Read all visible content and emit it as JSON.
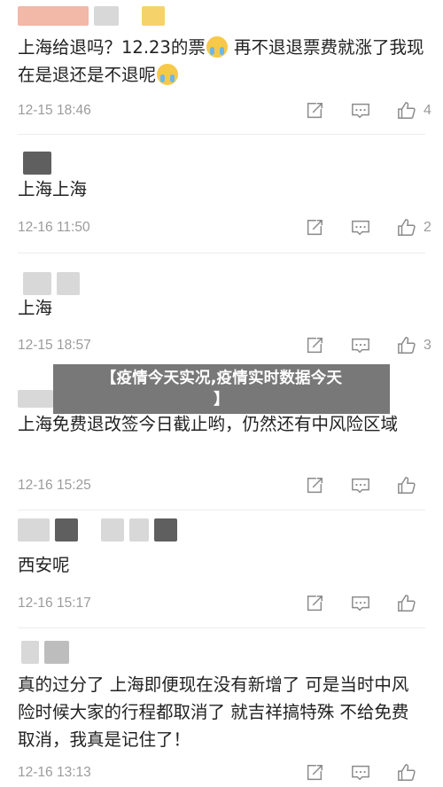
{
  "comments": [
    {
      "text_part1": "上海给退吗？12.23的票",
      "text_part2": " 再不退退票费就涨了我现在是退还是不退呢",
      "emoji_1": "crying-face-emoji",
      "emoji_2": "crying-face-emoji",
      "time": "12-15 18:46",
      "likes": "4"
    },
    {
      "text": "上海上海",
      "time": "12-16 11:50",
      "likes": "2"
    },
    {
      "text": "上海",
      "time": "12-15 18:57",
      "likes": "3"
    },
    {
      "text": "上海免费退改签今日截止哟，仍然还有中风险区域",
      "time": "12-16 15:25",
      "likes": ""
    },
    {
      "text": "西安呢",
      "time": "12-16 15:17",
      "likes": ""
    },
    {
      "text": "真的过分了 上海即便现在没有新增了 可是当时中风险时候大家的行程都取消了 就吉祥搞特殊 不给免费取消，我真是记住了！",
      "time": "12-16 13:13",
      "likes": ""
    }
  ],
  "banner": {
    "line1": "【疫情今天实况,疫情实时数据今天",
    "line2": "】"
  },
  "icons": {
    "share": "share-icon",
    "reply": "comment-icon",
    "like": "thumbs-up-icon"
  },
  "colors": {
    "time_text": "#9b9b9b",
    "icon_stroke": "#8a8a8a",
    "banner_bg": "#5a5a5a"
  }
}
